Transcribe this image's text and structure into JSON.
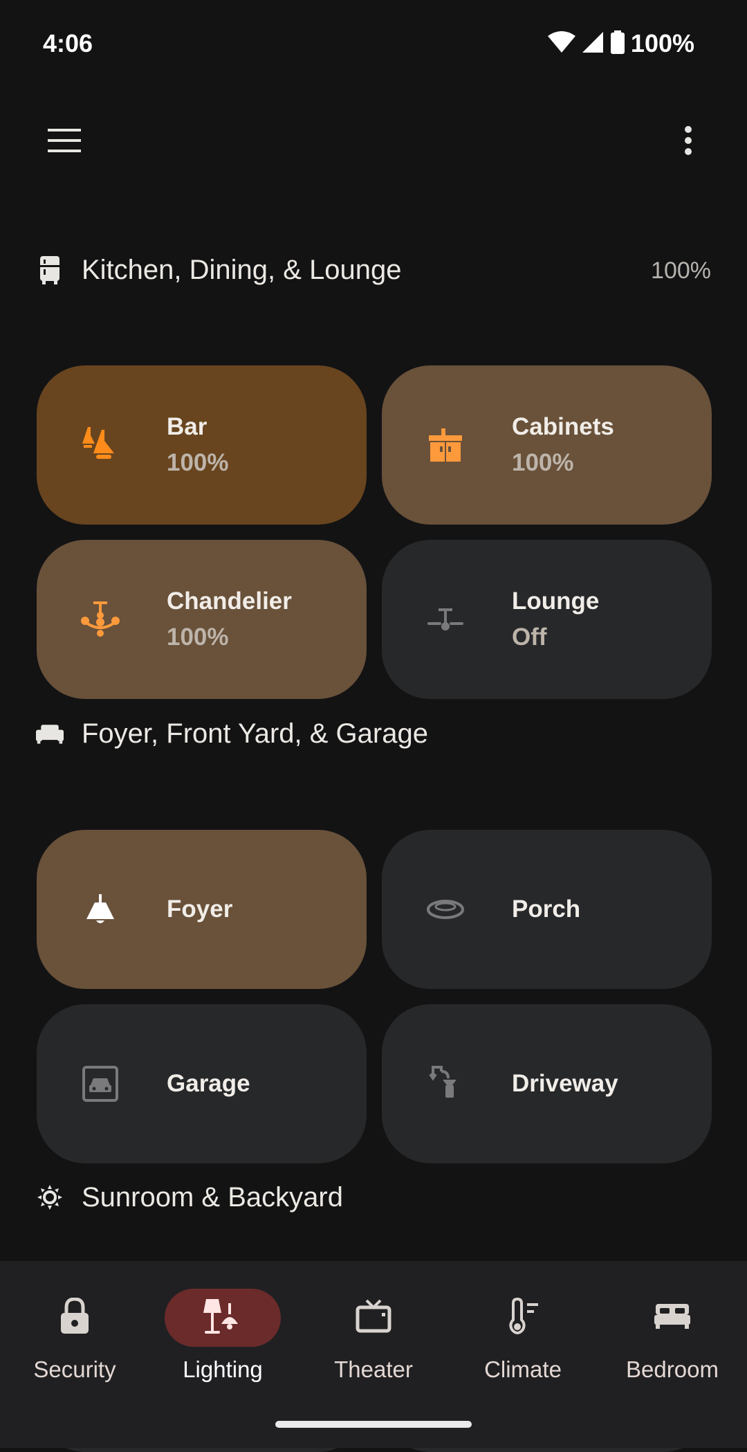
{
  "status_bar": {
    "time": "4:06",
    "battery": "100%"
  },
  "app_bar": {
    "menu_icon": "hamburger-menu-icon",
    "more_icon": "more-vert-icon"
  },
  "sections": [
    {
      "title": "Kitchen, Dining, & Lounge",
      "icon": "fridge-icon",
      "percent": "100%",
      "tiles": [
        {
          "name": "Bar",
          "state": "100%",
          "icon": "pendant-lights-icon",
          "status": "on-strong"
        },
        {
          "name": "Cabinets",
          "state": "100%",
          "icon": "cabinet-light-icon",
          "status": "on"
        },
        {
          "name": "Chandelier",
          "state": "100%",
          "icon": "chandelier-icon",
          "status": "on"
        },
        {
          "name": "Lounge",
          "state": "Off",
          "icon": "ceiling-fan-light-icon",
          "status": "off"
        }
      ]
    },
    {
      "title": "Foyer, Front Yard, & Garage",
      "icon": "sofa-icon",
      "tiles": [
        {
          "name": "Foyer",
          "icon": "ceiling-light-icon",
          "status": "on"
        },
        {
          "name": "Porch",
          "icon": "flush-mount-light-icon",
          "status": "off"
        },
        {
          "name": "Garage",
          "icon": "garage-icon",
          "status": "off"
        },
        {
          "name": "Driveway",
          "icon": "outdoor-lamp-icon",
          "status": "off"
        }
      ]
    },
    {
      "title": "Sunroom & Backyard",
      "icon": "sun-icon"
    }
  ],
  "bottom_nav": [
    {
      "label": "Security",
      "icon": "lock-icon",
      "active": false
    },
    {
      "label": "Lighting",
      "icon": "lamp-icon",
      "active": true
    },
    {
      "label": "Theater",
      "icon": "tv-icon",
      "active": false
    },
    {
      "label": "Climate",
      "icon": "thermometer-icon",
      "active": false
    },
    {
      "label": "Bedroom",
      "icon": "bed-icon",
      "active": false
    }
  ],
  "colors": {
    "background": "#131314",
    "tile_on_strong": "#68451f",
    "tile_on": "#69513a",
    "tile_off": "#27282a",
    "accent_orange": "#ff8c1a",
    "nav_active_pill": "#6b2b2b"
  }
}
